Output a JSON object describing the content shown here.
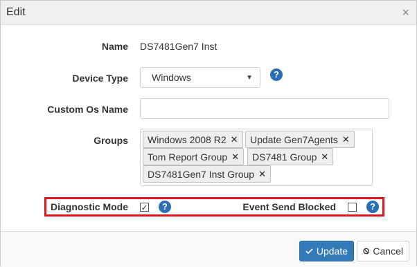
{
  "dialog": {
    "title": "Edit"
  },
  "fields": {
    "name_label": "Name",
    "name_value": "DS7481Gen7 Inst",
    "device_type_label": "Device Type",
    "device_type_value": "Windows",
    "custom_os_label": "Custom Os Name",
    "custom_os_value": "",
    "groups_label": "Groups",
    "groups": [
      "Windows 2008 R2",
      "Update Gen7Agents",
      "Tom Report Group",
      "DS7481 Group",
      "DS7481Gen7 Inst Group"
    ],
    "diagnostic_mode_label": "Diagnostic Mode",
    "diagnostic_mode_checked": true,
    "event_send_blocked_label": "Event Send Blocked",
    "event_send_blocked_checked": false
  },
  "icons": {
    "help": "?",
    "close": "×",
    "tag_remove": "✕",
    "caret": "▼",
    "check": "✓"
  },
  "footer": {
    "update_label": "Update",
    "cancel_label": "Cancel"
  },
  "colors": {
    "primary": "#337ab7",
    "help_icon": "#2a6fb5",
    "highlight_border": "#e0141e"
  }
}
